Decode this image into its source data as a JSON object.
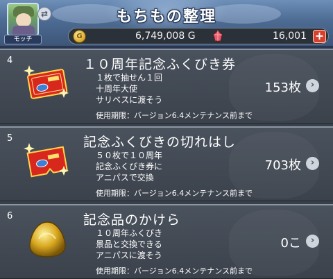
{
  "header": {
    "title": "もちもの整理",
    "avatar_name": "モッチ",
    "swap_icon": "⇄",
    "gold_symbol": "G",
    "gold": "6,749,008 G",
    "gems": "16,001",
    "plus_label": "+"
  },
  "items": [
    {
      "index": "4",
      "name": "１０周年記念ふくびき券",
      "desc": [
        "１枚で抽せん１回",
        "十周年大使",
        "サリベスに渡そう"
      ],
      "count": "153枚",
      "expiry": "使用期限：バージョン6.4メンテナンス前まで",
      "icon": "ticket-icon"
    },
    {
      "index": "5",
      "name": "記念ふくびきの切れはし",
      "desc": [
        "５０枚で１０周年",
        "記念ふくびき券に",
        "アニパスで交換"
      ],
      "count": "703枚",
      "expiry": "使用期限：バージョン6.4メンテナンス前まで",
      "icon": "ticket-scrap-icon"
    },
    {
      "index": "6",
      "name": "記念品のかけら",
      "desc": [
        "１０周年ふくびき",
        "景品と交換できる",
        "アニパスに渡そう"
      ],
      "count": "0こ",
      "expiry": "使用期限：バージョン6.4メンテナンス前まで",
      "icon": "gold-fragment-icon"
    }
  ],
  "arrow_glyph": "›",
  "colors": {
    "plus": "#d8402c",
    "gold": "#d8a623",
    "gem": "#e03a4a"
  }
}
